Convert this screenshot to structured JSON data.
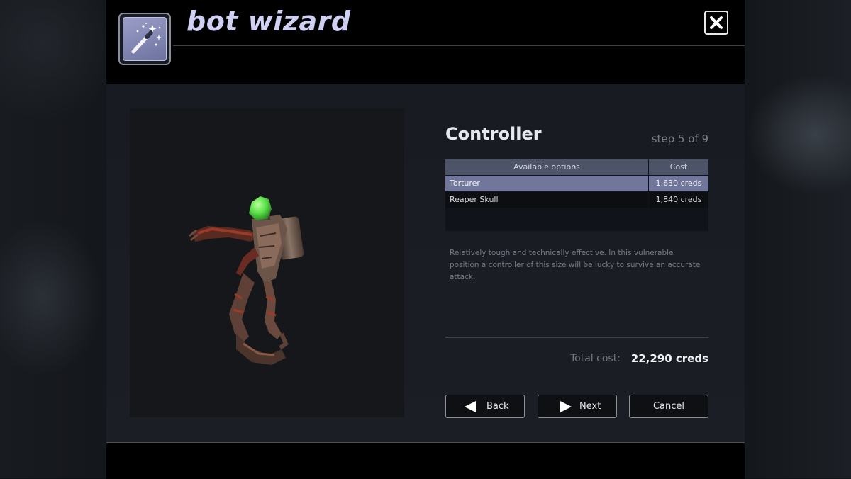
{
  "window": {
    "title": "bot wizard",
    "close_icon": "close-icon",
    "wand_icon": "magic-wand-icon"
  },
  "step": {
    "title": "Controller",
    "counter": "step 5 of 9"
  },
  "options": {
    "headers": [
      "Available options",
      "Cost"
    ],
    "rows": [
      {
        "name": "Torturer",
        "cost": "1,630 creds",
        "selected": true
      },
      {
        "name": "Reaper Skull",
        "cost": "1,840 creds",
        "selected": false
      }
    ]
  },
  "description": "Relatively tough and technically effective. In this vulnerable position a controller of this size will be lucky to survive an accurate attack.",
  "total": {
    "label": "Total cost:",
    "value": "22,290 creds"
  },
  "buttons": {
    "back": "Back",
    "next": "Next",
    "cancel": "Cancel"
  },
  "colors": {
    "title": "#cfd0f2",
    "selected_row": "#71779a",
    "header_row": "#4d5468",
    "controller_head": "#5be04a"
  }
}
